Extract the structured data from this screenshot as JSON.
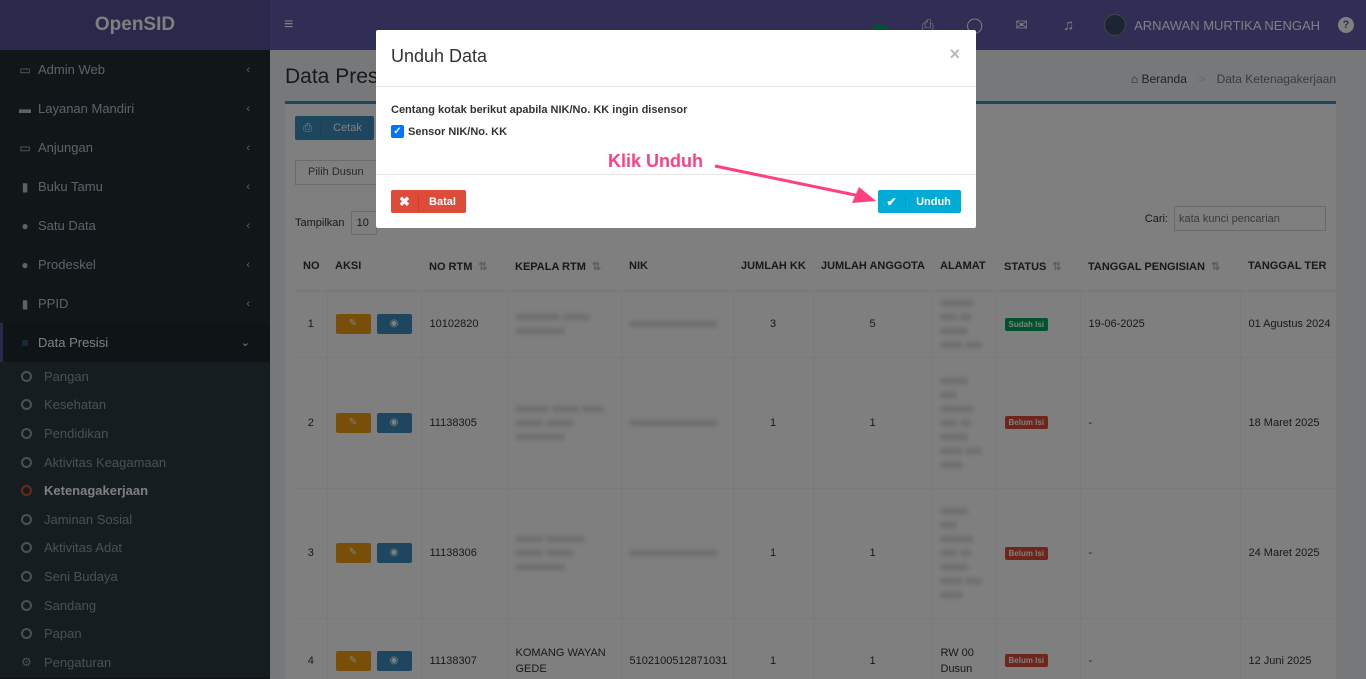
{
  "app": {
    "logo": "OpenSID"
  },
  "sidebar": {
    "items": [
      {
        "label": "Admin Web",
        "icon": "desktop-icon"
      },
      {
        "label": "Layanan Mandiri",
        "icon": "laptop-icon"
      },
      {
        "label": "Anjungan",
        "icon": "monitor-icon"
      },
      {
        "label": "Buku Tamu",
        "icon": "book-icon"
      },
      {
        "label": "Satu Data",
        "icon": "globe-icon"
      },
      {
        "label": "Prodeskel",
        "icon": "globe-icon"
      },
      {
        "label": "PPID",
        "icon": "book-icon"
      },
      {
        "label": "Data Presisi",
        "icon": "database-icon"
      }
    ],
    "subitems": [
      {
        "label": "Pangan"
      },
      {
        "label": "Kesehatan"
      },
      {
        "label": "Pendidikan"
      },
      {
        "label": "Aktivitas Keagamaan"
      },
      {
        "label": "Ketenagakerjaan"
      },
      {
        "label": "Jaminan Sosial"
      },
      {
        "label": "Aktivitas Adat"
      },
      {
        "label": "Seni Budaya"
      },
      {
        "label": "Sandang"
      },
      {
        "label": "Papan"
      },
      {
        "label": "Pengaturan"
      }
    ]
  },
  "navbar": {
    "user_name": "ARNAWAN MURTIKA NENGAH",
    "help": "?"
  },
  "page": {
    "title": "Data Presisi",
    "breadcrumb_home": "Beranda",
    "breadcrumb_current": "Data Ketenagakerjaan",
    "cetak_label": "Cetak",
    "pilih_dusun": "Pilih Dusun",
    "tampilkan_label": "Tampilkan",
    "tampilkan_value": "10",
    "cari_label": "Cari:",
    "cari_placeholder": "kata kunci pencarian"
  },
  "table": {
    "headers": [
      "NO",
      "AKSI",
      "NO RTM",
      "KEPALA RTM",
      "NIK",
      "JUMLAH KK",
      "JUMLAH ANGGOTA",
      "ALAMAT",
      "STATUS",
      "TANGGAL PENGISIAN",
      "TANGGAL TER"
    ],
    "rows": [
      {
        "no": "1",
        "no_rtm": "10102820",
        "kepala": "xxxxxxxx xxxxx xxxxxxxxx",
        "nik": "xxxxxxxxxxxxxxxx",
        "kk": "3",
        "anggota": "5",
        "alamat": "xxxxxx xxx xx xxxxx xxxx xxx",
        "status": "Sudah Isi",
        "tgl_isi": "19-06-2025",
        "tgl_ter": "01 Agustus 2024"
      },
      {
        "no": "2",
        "no_rtm": "11138305",
        "kepala": "xxxxxx xxxxx xxxx xxxxx xxxxx xxxxxxxxx",
        "nik": "xxxxxxxxxxxxxxxx",
        "kk": "1",
        "anggota": "1",
        "alamat": "xxxxx xxx xxxxxx xxx xx xxxxx xxxx xxx xxxx",
        "status": "Belum Isi",
        "tgl_isi": "-",
        "tgl_ter": "18 Maret 2025"
      },
      {
        "no": "3",
        "no_rtm": "11138306",
        "kepala": "xxxxx xxxxxxx xxxxx xxxxx xxxxxxxxx",
        "nik": "xxxxxxxxxxxxxxxx",
        "kk": "1",
        "anggota": "1",
        "alamat": "xxxxx xxx xxxxxx xxx xx xxxxx xxxx xxx xxxx",
        "status": "Belum Isi",
        "tgl_isi": "-",
        "tgl_ter": "24 Maret 2025"
      },
      {
        "no": "4",
        "no_rtm": "11138307",
        "kepala_line1": "KOMANG WAYAN",
        "kepala_line2": "GEDE",
        "nik": "5102100512871031",
        "kk": "1",
        "anggota": "1",
        "alamat_line1": "RW 00",
        "alamat_line2": "Dusun",
        "status": "Belum Isi",
        "tgl_isi": "-",
        "tgl_ter": "12 Juni 2025"
      }
    ]
  },
  "modal": {
    "title": "Unduh Data",
    "close": "×",
    "description": "Centang kotak berikut apabila NIK/No. KK ingin disensor",
    "checkbox_label": "Sensor NIK/No. KK",
    "checkbox_checked": true,
    "batal_label": "Batal",
    "unduh_label": "Unduh"
  },
  "annotation": {
    "text": "Klik Unduh",
    "color": "#ff3f7f"
  },
  "colors": {
    "navbar": "#605ca8",
    "sidebar": "#222d32",
    "primary": "#3c8dbc",
    "danger": "#dd4b39",
    "info": "#00acd6",
    "warning": "#f39c12",
    "success": "#00a65a"
  }
}
